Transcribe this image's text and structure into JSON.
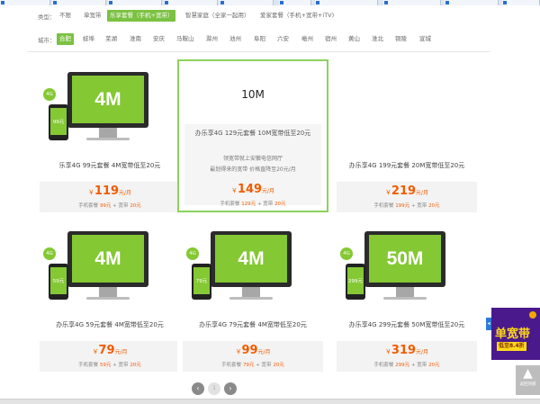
{
  "filters": {
    "type": {
      "label": "类型：",
      "options": [
        "不限",
        "单宽带",
        "乐享套餐（手机+宽带）",
        "智慧家庭（全家一起用）",
        "爱家套餐（手机+宽带+iTV)"
      ],
      "active": 2
    },
    "city": {
      "label": "城市：",
      "options": [
        "合肥",
        "蚌埠",
        "芜湖",
        "淮南",
        "安庆",
        "马鞍山",
        "滁州",
        "池州",
        "阜阳",
        "六安",
        "亳州",
        "宿州",
        "黄山",
        "淮北",
        "铜陵",
        "宣城"
      ],
      "active": 0
    }
  },
  "products": [
    {
      "speed": "4M",
      "phone_price": "99元",
      "title": "乐享4G 99元套餐 4M宽带低至20元",
      "price": "119",
      "currency": "￥",
      "unit": "元/月",
      "detail_prefix": "手机套餐",
      "phone_fee": "99元",
      "plus": "+",
      "broadband_label": "宽带",
      "broadband_fee": "20元"
    },
    {
      "speed": "10M",
      "title": "办乐享4G 129元套餐 10M宽带低至20元",
      "desc1": "领宽带就上安徽电信网厅",
      "desc2": "最划得来的宽带 价格直降至20元/月",
      "price": "149",
      "currency": "￥",
      "unit": "元/月",
      "detail_prefix": "手机套餐",
      "phone_fee": "129元",
      "plus": "+",
      "broadband_label": "宽带",
      "broadband_fee": "20元"
    },
    {
      "title": "办乐享4G 199元套餐 20M宽带低至20元",
      "price": "219",
      "currency": "￥",
      "unit": "元/月",
      "detail_prefix": "手机套餐",
      "phone_fee": "199元",
      "plus": "+",
      "broadband_label": "宽带",
      "broadband_fee": "20元"
    },
    {
      "speed": "4M",
      "phone_price": "59元",
      "title": "办乐享4G 59元套餐 4M宽带低至20元",
      "price": "79",
      "currency": "￥",
      "unit": "元/月",
      "detail_prefix": "手机套餐",
      "phone_fee": "59元",
      "plus": "+",
      "broadband_label": "宽带",
      "broadband_fee": "20元"
    },
    {
      "speed": "4M",
      "phone_price": "79元",
      "title": "办乐享4G 79元套餐 4M宽带低至20元",
      "price": "99",
      "currency": "￥",
      "unit": "元/月",
      "detail_prefix": "手机套餐",
      "phone_fee": "79元",
      "plus": "+",
      "broadband_label": "宽带",
      "broadband_fee": "20元"
    },
    {
      "speed": "50M",
      "phone_price": "299元",
      "title": "办乐享4G 299元套餐 50M宽带低至20元",
      "price": "319",
      "currency": "￥",
      "unit": "元/月",
      "detail_prefix": "手机套餐",
      "phone_fee": "299元",
      "plus": "+",
      "broadband_label": "宽带",
      "broadband_fee": "20元"
    }
  ],
  "badge_4g": "4G",
  "pagination": {
    "prev": "‹",
    "page": "1",
    "next": "›"
  },
  "promo": {
    "title": "单宽带",
    "subtitle": "低至8.4折"
  },
  "back_to_top": {
    "label": "返回顶部",
    "arrow": "▲"
  },
  "colors": {
    "accent": "#7bc142",
    "price": "#f25b00",
    "screen": "#84c833"
  }
}
